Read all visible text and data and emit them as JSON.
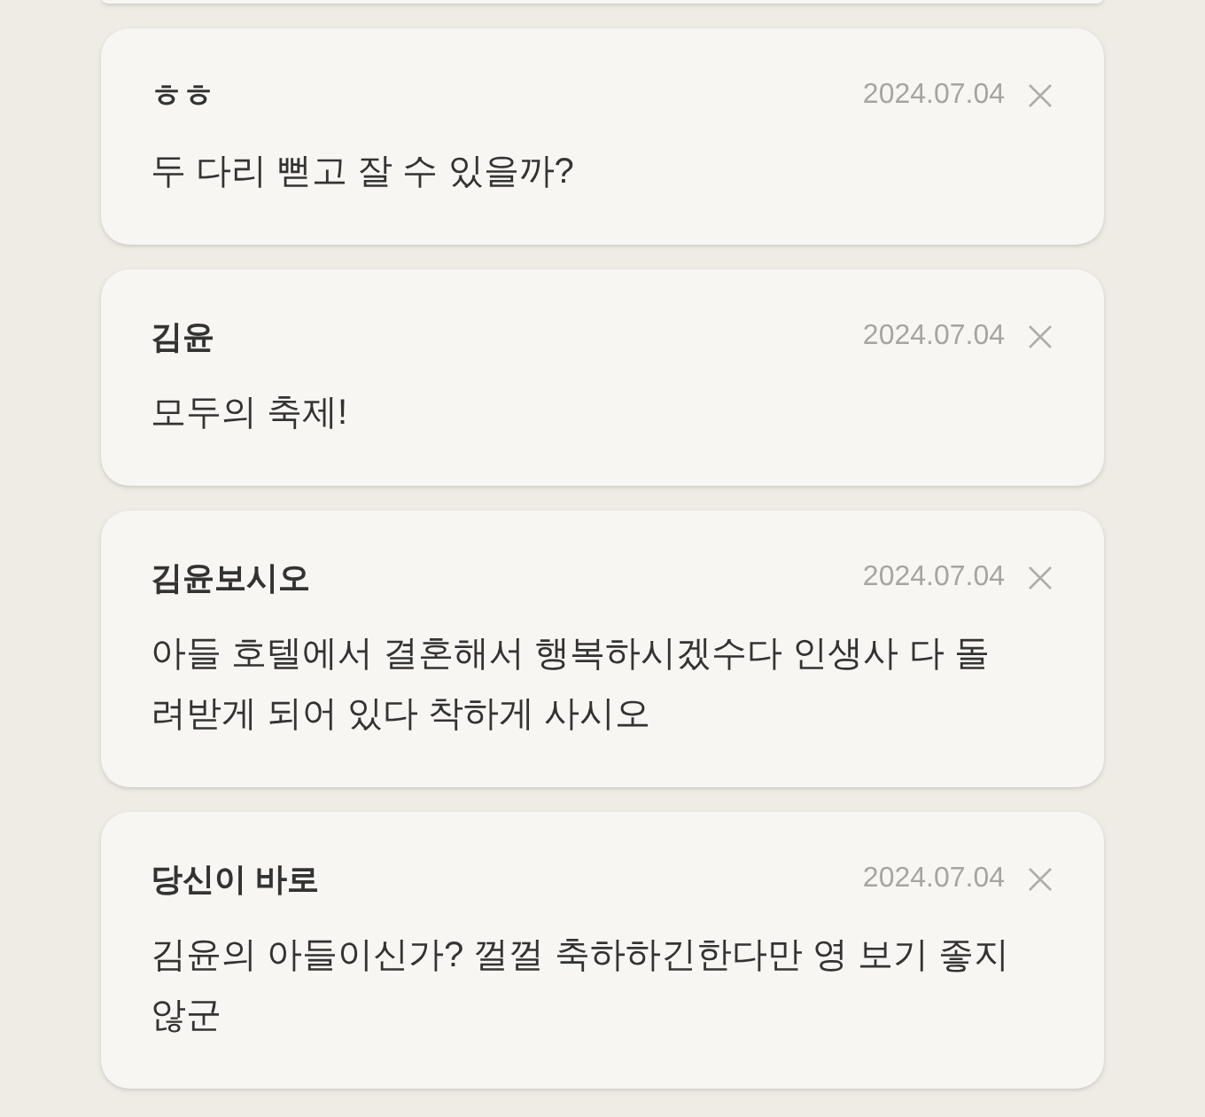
{
  "comments": [
    {
      "author": "ㅎㅎ",
      "date": "2024.07.04",
      "text": "두 다리 뻗고 잘 수 있을까?"
    },
    {
      "author": "김윤",
      "date": "2024.07.04",
      "text": "모두의 축제!"
    },
    {
      "author": "김윤보시오",
      "date": "2024.07.04",
      "text": "아들 호텔에서 결혼해서 행복하시겠수다 인생사 다 돌려받게 되어 있다 착하게 사시오"
    },
    {
      "author": "당신이 바로",
      "date": "2024.07.04",
      "text": "김윤의 아들이신가? 껄껄 축하하긴한다만 영 보기 좋지 않군"
    }
  ]
}
